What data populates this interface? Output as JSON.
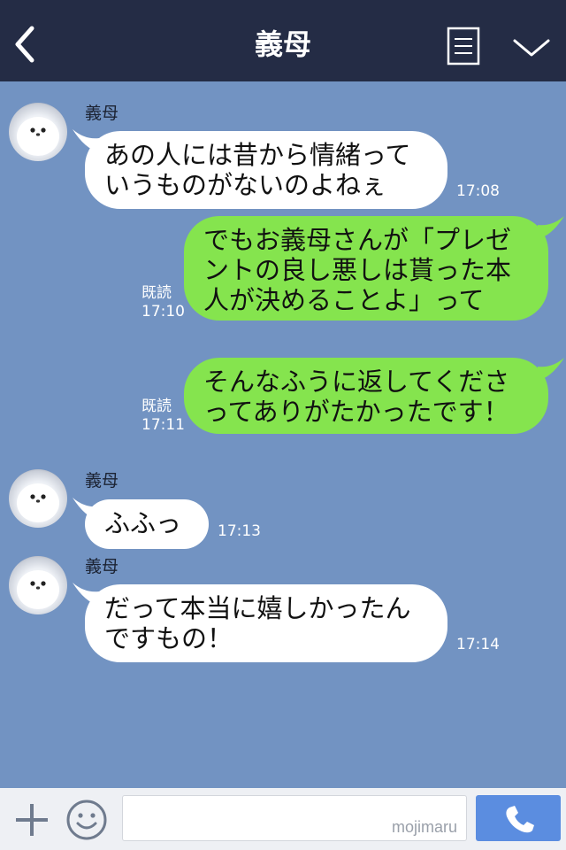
{
  "header": {
    "title": "義母",
    "back_icon": "chevron-left-icon",
    "notes_icon": "notes-icon",
    "menu_icon": "chevron-down-icon",
    "bg_color": "#242c45"
  },
  "chat": {
    "bg_color": "#7293c2",
    "incoming_color": "#ffffff",
    "outgoing_color": "#85e44e",
    "messages": [
      {
        "direction": "incoming",
        "sender": "義母",
        "text": "あの人には昔から情緒って\nいうものがないのよねぇ",
        "time": "17:08"
      },
      {
        "direction": "outgoing",
        "text": "でもお義母さんが「プレゼ\nントの良し悪しは貰った本\n人が決めることよ」って",
        "read": "既読",
        "time": "17:10"
      },
      {
        "direction": "outgoing",
        "text": "そんなふうに返してくださ\nってありがたかったです！",
        "read": "既読",
        "time": "17:11"
      },
      {
        "direction": "incoming",
        "sender": "義母",
        "text": "ふふっ",
        "time": "17:13"
      },
      {
        "direction": "incoming",
        "sender": "義母",
        "text": "だって本当に嬉しかったん\nですもの！",
        "time": "17:14"
      }
    ]
  },
  "footer": {
    "plus_icon": "plus-icon",
    "emoji_icon": "smiley-icon",
    "input_value": "",
    "watermark": "mojimaru",
    "call_icon": "phone-icon",
    "call_color": "#5b8de0"
  }
}
